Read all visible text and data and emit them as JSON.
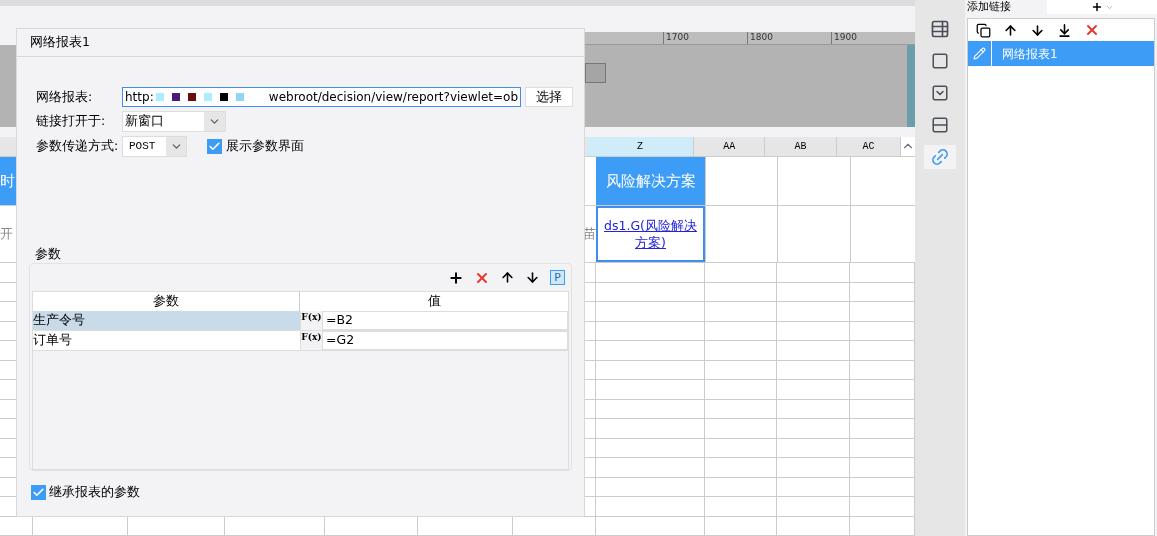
{
  "sheet": {
    "ruler_ticks": [
      "1700",
      "1800",
      "1900"
    ],
    "columns": [
      {
        "label": "Z",
        "selected": true
      },
      {
        "label": "AA",
        "selected": false
      },
      {
        "label": "AB",
        "selected": false
      },
      {
        "label": "AC",
        "selected": false
      }
    ],
    "left_header_fragment": "时",
    "left_cell_fragment": "开",
    "right_cell_fragment": "苗",
    "header_cell": "风险解决方案",
    "link_cell": "ds1.G(风险解决方案)"
  },
  "side_tools": [
    {
      "kind": "info",
      "selected": false
    },
    {
      "kind": "frame",
      "selected": false
    },
    {
      "kind": "dropdown",
      "selected": false
    },
    {
      "kind": "stack",
      "selected": false
    },
    {
      "kind": "link",
      "selected": true
    }
  ],
  "link_panel": {
    "title": "添加链接",
    "items": [
      {
        "label": "网络报表1",
        "selected": true
      }
    ]
  },
  "dialog": {
    "title": "网络报表1",
    "report_label": "网络报表:",
    "url_start": "http:",
    "url_end": "webroot/decision/view/report?viewlet=ob",
    "choose_button": "选择",
    "open_label": "链接打开于:",
    "open_value": "新窗口",
    "method_label": "参数传递方式:",
    "method_value": "POST",
    "show_params": {
      "label": "展示参数界面",
      "checked": true
    },
    "params": {
      "title": "参数",
      "p_button": "P",
      "columns": [
        "参数",
        "值"
      ],
      "rows": [
        {
          "name": "生产令号",
          "fx": "F(x)",
          "value": "=B2",
          "selected": true
        },
        {
          "name": "订单号",
          "fx": "F(x)",
          "value": "=G2",
          "selected": false
        }
      ]
    },
    "inherit": {
      "label": "继承报表的参数",
      "checked": true
    }
  }
}
